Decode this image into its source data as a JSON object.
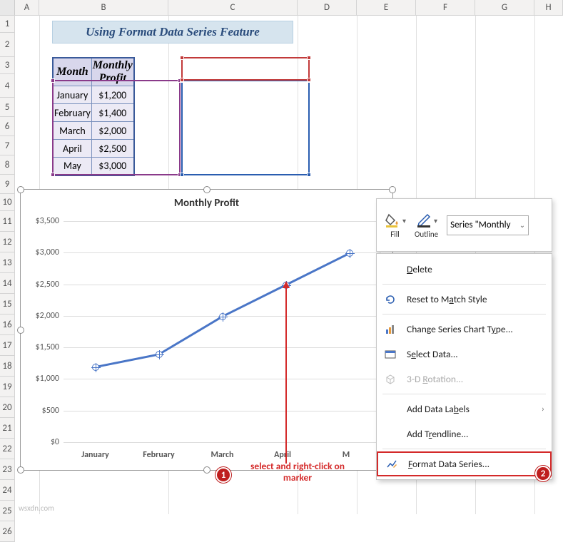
{
  "title": "Using Format Data Series Feature",
  "table": {
    "headers": [
      "Month",
      "Monthly Profit"
    ],
    "rows": [
      [
        "January",
        "$1,200"
      ],
      [
        "February",
        "$1,400"
      ],
      [
        "March",
        "$2,000"
      ],
      [
        "April",
        "$2,500"
      ],
      [
        "May",
        "$3,000"
      ]
    ]
  },
  "columns": [
    "A",
    "B",
    "C",
    "D",
    "E",
    "F",
    "G",
    "H"
  ],
  "rows": [
    "1",
    "2",
    "3",
    "4",
    "5",
    "6",
    "7",
    "8",
    "9",
    "10",
    "11",
    "12",
    "13",
    "14",
    "15",
    "16",
    "17",
    "18",
    "19",
    "20",
    "21",
    "22",
    "23",
    "24",
    "25",
    "26"
  ],
  "chart": {
    "title": "Monthly Profit",
    "ylabels": [
      "$0",
      "$500",
      "$1,000",
      "$1,500",
      "$2,000",
      "$2,500",
      "$3,000",
      "$3,500"
    ],
    "xlabels": [
      "January",
      "February",
      "March",
      "April",
      "M"
    ]
  },
  "chart_data": {
    "type": "line",
    "title": "Monthly Profit",
    "categories": [
      "January",
      "February",
      "March",
      "April",
      "May"
    ],
    "series": [
      {
        "name": "Monthly Profit",
        "values": [
          1200,
          1400,
          2000,
          2500,
          3000
        ]
      }
    ],
    "xlabel": "",
    "ylabel": "",
    "ylim": [
      0,
      3500
    ]
  },
  "mini_toolbar": {
    "fill": "Fill",
    "outline": "Outline",
    "series_combo": "Series \"Monthly"
  },
  "context_menu": {
    "delete": "Delete",
    "reset": "Reset to Match Style",
    "change_type": "Change Series Chart Type...",
    "select_data": "Select Data...",
    "rotation": "3-D Rotation...",
    "data_labels": "Add Data Labels",
    "trendline": "Add Trendline...",
    "format_series": "Format Data Series..."
  },
  "annotations": {
    "badge1": "1",
    "badge2": "2",
    "text1": "select and right-click on marker"
  },
  "watermark": "wsxdn.com"
}
